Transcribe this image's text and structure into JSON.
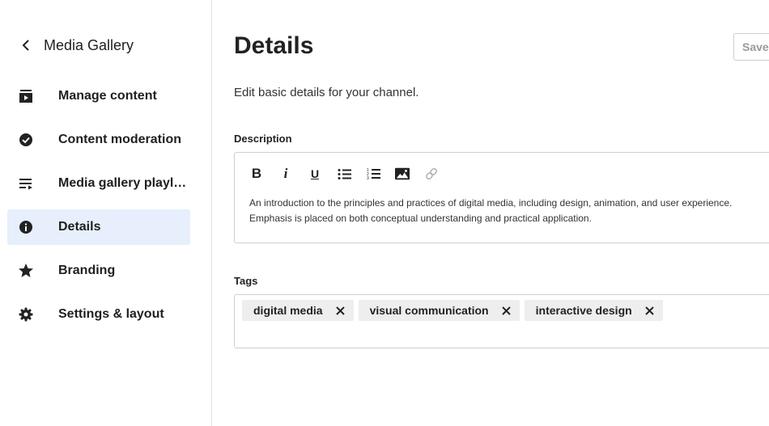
{
  "sidebar": {
    "back_title": "Media Gallery",
    "items": [
      {
        "label": "Manage content",
        "icon": "video-list-icon",
        "active": false
      },
      {
        "label": "Content moderation",
        "icon": "check-circle-icon",
        "active": false
      },
      {
        "label": "Media gallery playlists",
        "icon": "playlist-icon",
        "active": false
      },
      {
        "label": "Details",
        "icon": "info-circle-icon",
        "active": true
      },
      {
        "label": "Branding",
        "icon": "star-icon",
        "active": false
      },
      {
        "label": "Settings & layout",
        "icon": "gear-icon",
        "active": false
      }
    ]
  },
  "main": {
    "title": "Details",
    "save_label": "Save",
    "subtitle": "Edit basic details for your channel.",
    "description": {
      "label": "Description",
      "toolbar": {
        "bold": "B",
        "italic": "i",
        "underline": "U"
      },
      "text": "An introduction to the principles and practices of digital media, including design, animation, and user experience. Emphasis is placed on both conceptual understanding and practical application."
    },
    "tags": {
      "label": "Tags",
      "items": [
        "digital media",
        "visual communication",
        "interactive design"
      ]
    }
  },
  "colors": {
    "active_bg": "#e6effb",
    "border": "#cfcfcf",
    "chip_bg": "#eeeeee"
  }
}
